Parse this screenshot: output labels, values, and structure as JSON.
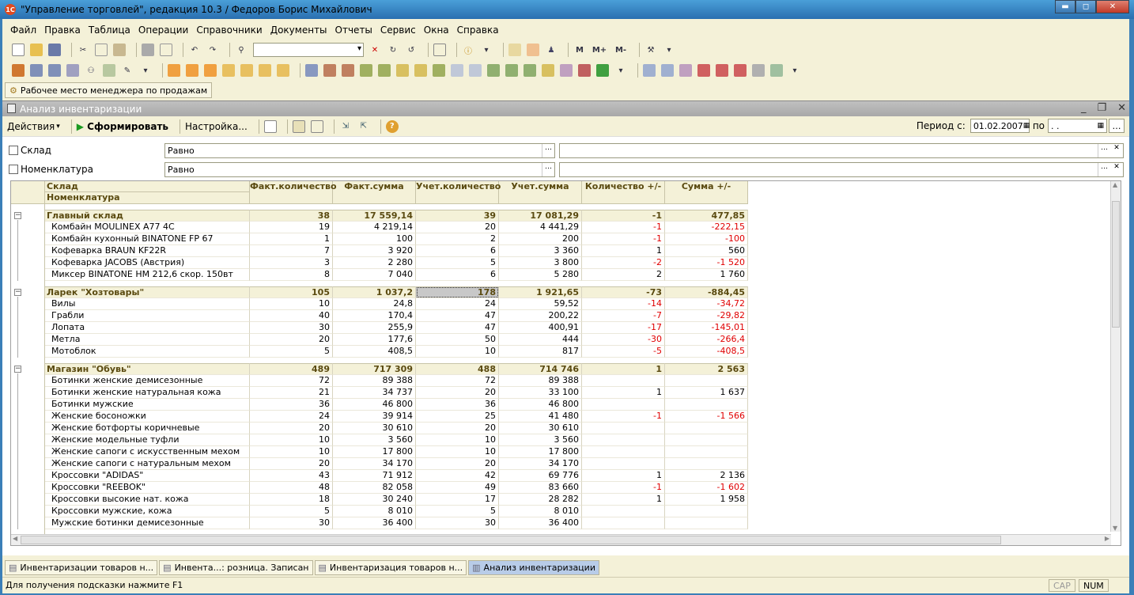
{
  "window": {
    "title": "\"Управление торговлей\", редакция 10.3 / Федоров Борис Михайлович",
    "app_icon": "1С",
    "btn_min": "▬",
    "btn_max": "◻",
    "btn_close": "✕"
  },
  "menu": [
    "Файл",
    "Правка",
    "Таблица",
    "Операции",
    "Справочники",
    "Документы",
    "Отчеты",
    "Сервис",
    "Окна",
    "Справка"
  ],
  "toolbar2_labels": {
    "m": "M",
    "mplus": "M+",
    "mminus": "M-"
  },
  "workplace_button": "Рабочее место менеджера по продажам",
  "report": {
    "title": "Анализ инвентаризации",
    "actions": "Действия",
    "generate": "Сформировать",
    "settings": "Настройка...",
    "period_from_label": "Период с:",
    "period_from": "01.02.2007",
    "period_to_label": "по",
    "period_to": ". .",
    "filters": [
      {
        "label": "Склад",
        "condition": "Равно"
      },
      {
        "label": "Номенклатура",
        "condition": "Равно"
      }
    ],
    "headers": {
      "col1_top": "Склад",
      "col1_bottom": "Номенклатура",
      "cols": [
        "Факт.количество",
        "Факт.сумма",
        "Учет.количество",
        "Учет.сумма",
        "Количество +/-",
        "Сумма +/-"
      ]
    },
    "groups": [
      {
        "name": "Главный склад",
        "vals": [
          "38",
          "17 559,14",
          "39",
          "17 081,29",
          "-1",
          "477,85"
        ],
        "items": [
          {
            "name": "Комбайн MOULINEX  A77 4C",
            "vals": [
              "19",
              "4 219,14",
              "20",
              "4 441,29",
              "-1",
              "-222,15"
            ]
          },
          {
            "name": "Комбайн кухонный BINATONE FP 67",
            "vals": [
              "1",
              "100",
              "2",
              "200",
              "-1",
              "-100"
            ]
          },
          {
            "name": "Кофеварка BRAUN KF22R",
            "vals": [
              "7",
              "3 920",
              "6",
              "3 360",
              "1",
              "560"
            ]
          },
          {
            "name": "Кофеварка JACOBS (Австрия)",
            "vals": [
              "3",
              "2 280",
              "5",
              "3 800",
              "-2",
              "-1 520"
            ]
          },
          {
            "name": "Миксер BINATONE HM 212,6 скор. 150вт",
            "vals": [
              "8",
              "7 040",
              "6",
              "5 280",
              "2",
              "1 760"
            ]
          }
        ]
      },
      {
        "name": "Ларек \"Хозтовары\"",
        "vals": [
          "105",
          "1 037,2",
          "178",
          "1 921,65",
          "-73",
          "-884,45"
        ],
        "items": [
          {
            "name": "Вилы",
            "vals": [
              "10",
              "24,8",
              "24",
              "59,52",
              "-14",
              "-34,72"
            ]
          },
          {
            "name": "Грабли",
            "vals": [
              "40",
              "170,4",
              "47",
              "200,22",
              "-7",
              "-29,82"
            ]
          },
          {
            "name": "Лопата",
            "vals": [
              "30",
              "255,9",
              "47",
              "400,91",
              "-17",
              "-145,01"
            ]
          },
          {
            "name": "Метла",
            "vals": [
              "20",
              "177,6",
              "50",
              "444",
              "-30",
              "-266,4"
            ]
          },
          {
            "name": "Мотоблок",
            "vals": [
              "5",
              "408,5",
              "10",
              "817",
              "-5",
              "-408,5"
            ]
          }
        ]
      },
      {
        "name": "Магазин \"Обувь\"",
        "vals": [
          "489",
          "717 309",
          "488",
          "714 746",
          "1",
          "2 563"
        ],
        "items": [
          {
            "name": "Ботинки женские демисезонные",
            "vals": [
              "72",
              "89 388",
              "72",
              "89 388",
              "",
              ""
            ]
          },
          {
            "name": "Ботинки женские натуральная кожа",
            "vals": [
              "21",
              "34 737",
              "20",
              "33 100",
              "1",
              "1 637"
            ]
          },
          {
            "name": "Ботинки мужские",
            "vals": [
              "36",
              "46 800",
              "36",
              "46 800",
              "",
              ""
            ]
          },
          {
            "name": "Женские босоножки",
            "vals": [
              "24",
              "39 914",
              "25",
              "41 480",
              "-1",
              "-1 566"
            ]
          },
          {
            "name": "Женские ботфорты коричневые",
            "vals": [
              "20",
              "30 610",
              "20",
              "30 610",
              "",
              ""
            ]
          },
          {
            "name": "Женские модельные туфли",
            "vals": [
              "10",
              "3 560",
              "10",
              "3 560",
              "",
              ""
            ]
          },
          {
            "name": "Женские сапоги с искусственным мехом",
            "vals": [
              "10",
              "17 800",
              "10",
              "17 800",
              "",
              ""
            ]
          },
          {
            "name": "Женские сапоги с натуральным мехом",
            "vals": [
              "20",
              "34 170",
              "20",
              "34 170",
              "",
              ""
            ]
          },
          {
            "name": "Кроссовки \"ADIDAS\"",
            "vals": [
              "43",
              "71 912",
              "42",
              "69 776",
              "1",
              "2 136"
            ]
          },
          {
            "name": "Кроссовки \"REEBOK\"",
            "vals": [
              "48",
              "82 058",
              "49",
              "83 660",
              "-1",
              "-1 602"
            ]
          },
          {
            "name": "Кроссовки высокие нат. кожа",
            "vals": [
              "18",
              "30 240",
              "17",
              "28 282",
              "1",
              "1 958"
            ]
          },
          {
            "name": "Кроссовки мужские, кожа",
            "vals": [
              "5",
              "8 010",
              "5",
              "8 010",
              "",
              ""
            ]
          },
          {
            "name": "Мужские ботинки демисезонные",
            "vals": [
              "30",
              "36 400",
              "30",
              "36 400",
              "",
              ""
            ]
          }
        ]
      }
    ]
  },
  "taskbar": [
    "Инвентаризации товаров н...",
    "Инвента...: розница. Записан",
    "Инвентаризация товаров н...",
    "Анализ инвентаризации"
  ],
  "status": {
    "hint": "Для получения подсказки нажмите F1",
    "cap": "CAP",
    "num": "NUM"
  },
  "colors": {
    "negative": "#e00000",
    "group_text": "#5a4a10",
    "frame_bg": "#f4f1d8"
  }
}
